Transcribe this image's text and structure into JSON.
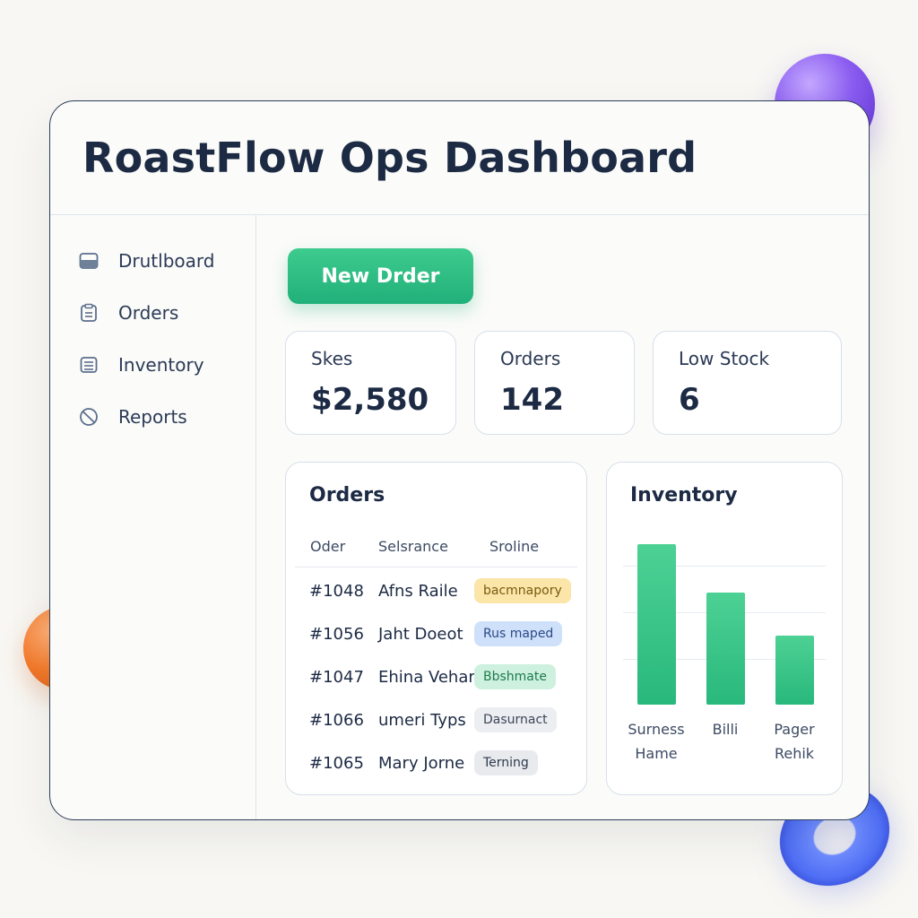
{
  "app": {
    "title": "RoastFlow Ops Dashboard"
  },
  "sidebar": {
    "items": [
      {
        "label": "Drutlboard",
        "icon": "dashboard-icon"
      },
      {
        "label": "Orders",
        "icon": "clipboard-icon"
      },
      {
        "label": "Inventory",
        "icon": "list-icon"
      },
      {
        "label": "Reports",
        "icon": "pie-chart-icon"
      }
    ]
  },
  "toolbar": {
    "new_order_label": "New Drder"
  },
  "stats": [
    {
      "label": "Skes",
      "value": "$2,580"
    },
    {
      "label": "Orders",
      "value": "142"
    },
    {
      "label": "Low Stock",
      "value": "6"
    }
  ],
  "orders": {
    "title": "Orders",
    "columns": [
      "Oder",
      "Selsrance",
      "Sroline"
    ],
    "rows": [
      {
        "id": "#1048",
        "name": "Afns Raile",
        "status": "bacmnapory",
        "status_color": "#fbe5a8",
        "status_text": "#7a5a10"
      },
      {
        "id": "#1056",
        "name": "Jaht Doeot",
        "status": "Rus maped",
        "status_color": "#cfe0fb",
        "status_text": "#2a4a86"
      },
      {
        "id": "#1047",
        "name": "Ehina Vehart",
        "status": "Bbshmate",
        "status_color": "#cdf1de",
        "status_text": "#1f7a4e"
      },
      {
        "id": "#1066",
        "name": "umeri Typs",
        "status": "Dasurnact",
        "status_color": "#eceef1",
        "status_text": "#3b4658"
      },
      {
        "id": "#1065",
        "name": "Mary Jorne",
        "status": "Terning",
        "status_color": "#e8eaed",
        "status_text": "#2e3a4e"
      }
    ]
  },
  "inventory": {
    "title": "Inventory",
    "chart_data": {
      "type": "bar",
      "categories": [
        "Surness Hame",
        "Billi",
        "Pager Rehik"
      ],
      "values": [
        100,
        70,
        43
      ],
      "ylim": [
        0,
        115
      ],
      "grid": true,
      "color": "#2fbe81"
    }
  },
  "decor": {
    "accent": "#21b07a",
    "text": "#1c2a44"
  }
}
